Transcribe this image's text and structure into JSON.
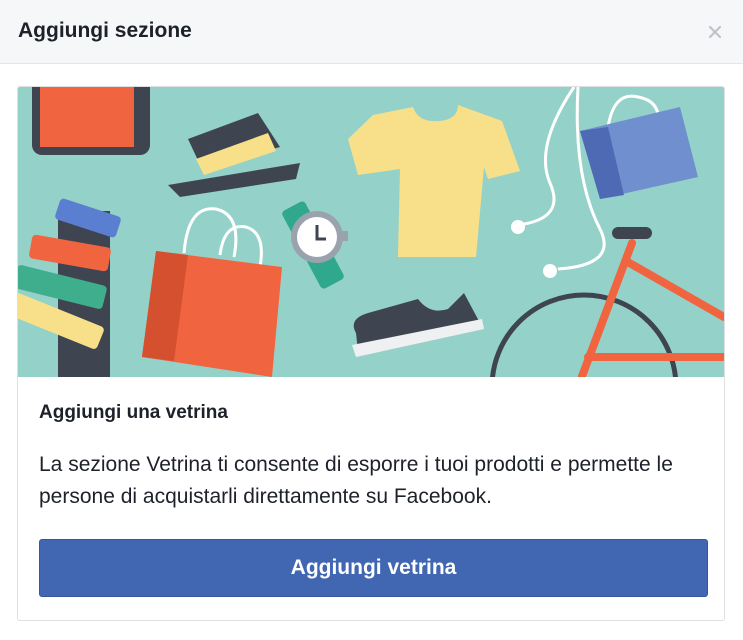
{
  "dialog": {
    "title": "Aggiungi sezione",
    "close_icon": "close-icon"
  },
  "card": {
    "illustration": "shop-illustration",
    "heading": "Aggiungi una vetrina",
    "description": "La sezione Vetrina ti consente di esporre i tuoi prodotti e permette le persone di acquistarli direttamente su Facebook.",
    "button_label": "Aggiungi vetrina"
  },
  "colors": {
    "header_bg": "#f6f7f9",
    "illustration_bg": "#94d2c9",
    "accent": "#4267b2",
    "text": "#1d2129"
  }
}
